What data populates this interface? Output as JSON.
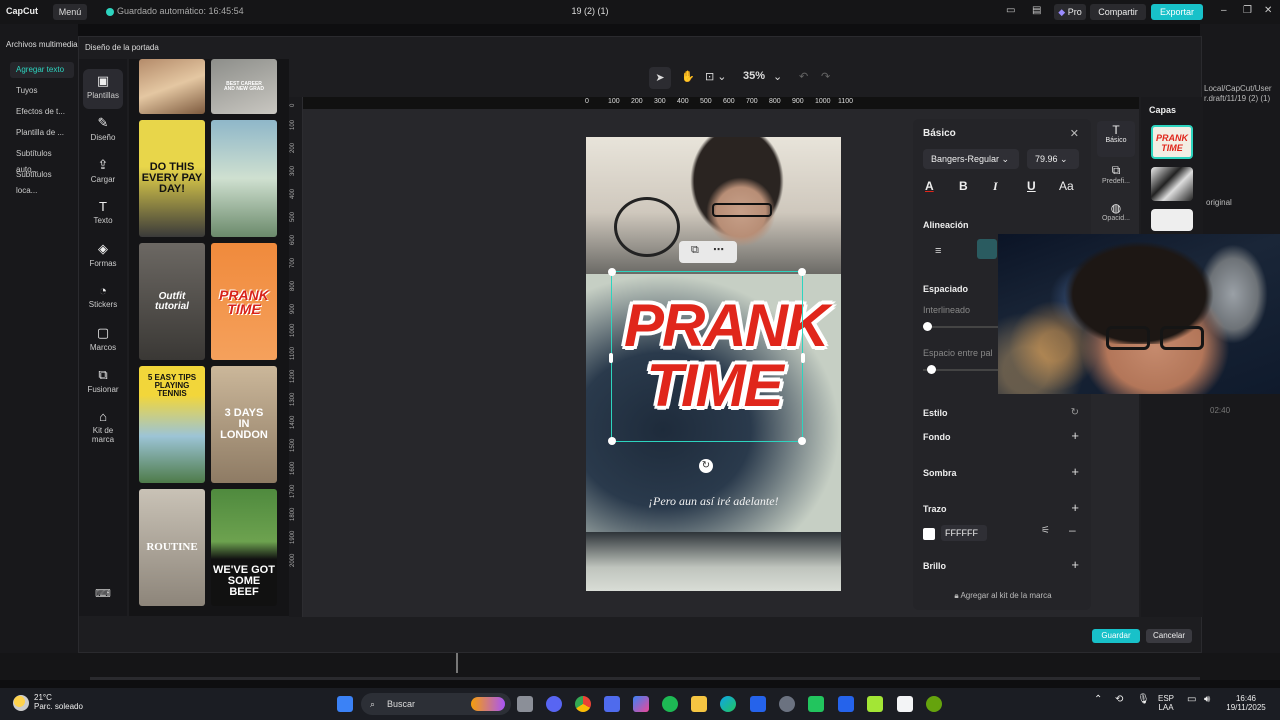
{
  "app": {
    "logo": "CapCut",
    "menu_label": "Menú",
    "autosave": "Guardado automático: 16:45:54",
    "project_title": "19 (2) (1)",
    "pro_label": "Pro",
    "share_label": "Compartir",
    "export_label": "Exportar"
  },
  "background_left": {
    "media_tab": "Archivos multimedia",
    "items": [
      "Agregar texto",
      "Tuyos",
      "Efectos de t...",
      "Plantilla de ...",
      "Subtítulos auto...",
      "Subtítulos loca..."
    ]
  },
  "background_right": {
    "path_line1": "Local/CapCut/User",
    "path_line2": "r.draft/11/19 (2) (1)",
    "original": "original",
    "time": "02:40"
  },
  "modal": {
    "title": "Diseño de la portada",
    "nav": [
      "Plantillas",
      "Diseño",
      "Cargar",
      "Texto",
      "Formas",
      "Stickers",
      "Marcos",
      "Fusionar",
      "Kit de marca"
    ],
    "templates": [
      {
        "text": ""
      },
      {
        "text": "BEST CAREER\nAND NEW GRAD"
      },
      {
        "text": "DO THIS\nEVERY PAY DAY!"
      },
      {
        "text": ""
      },
      {
        "text": "Outfit\ntutorial"
      },
      {
        "text": "PRANK\nTIME"
      },
      {
        "text": "5 EASY TIPS\nPLAYING TENNIS"
      },
      {
        "text": "3 DAYS\nIN\nLONDON"
      },
      {
        "text": "ROUTINE"
      },
      {
        "text": "WE'VE GOT\nSOME BEEF"
      }
    ],
    "zoom": "35%",
    "ruler_h": [
      "0",
      "100",
      "200",
      "300",
      "400",
      "500",
      "600",
      "700",
      "800",
      "900",
      "1000",
      "1100"
    ],
    "ruler_v": [
      "0",
      "100",
      "200",
      "300",
      "400",
      "500",
      "600",
      "700",
      "800",
      "900",
      "1000",
      "1100",
      "1200",
      "1300",
      "1400",
      "1500",
      "1600",
      "1700",
      "1800",
      "1900",
      "2000"
    ],
    "poster": {
      "headline_1": "PRANK",
      "headline_2": "TIME",
      "subtitle": "¡Pero aun así iré adelante!"
    },
    "properties": {
      "title": "Básico",
      "font": "Bangers-Regular",
      "size": "79.96",
      "alignment": "Alineación",
      "spacing": "Espaciado",
      "line_height": "Interlineado",
      "letter_spacing": "Espacio entre pal",
      "style": "Estilo",
      "background": "Fondo",
      "shadow": "Sombra",
      "stroke": "Trazo",
      "stroke_color": "FFFFFF",
      "brightness": "Brillo",
      "brand_kit": "Agregar al kit de la marca"
    },
    "side_tabs": [
      "Básico",
      "Predefi...",
      "Opacid..."
    ],
    "layers_title": "Capas",
    "save_label": "Guardar",
    "cancel_label": "Cancelar"
  },
  "taskbar": {
    "temperature": "21°C",
    "weather": "Parc. soleado",
    "search_placeholder": "Buscar",
    "lang_1": "ESP",
    "lang_2": "LAA",
    "time": "16:46",
    "date": "19/11/2025"
  },
  "colors": {
    "accent": "#18c1c9",
    "headline_red": "#e0261b"
  }
}
